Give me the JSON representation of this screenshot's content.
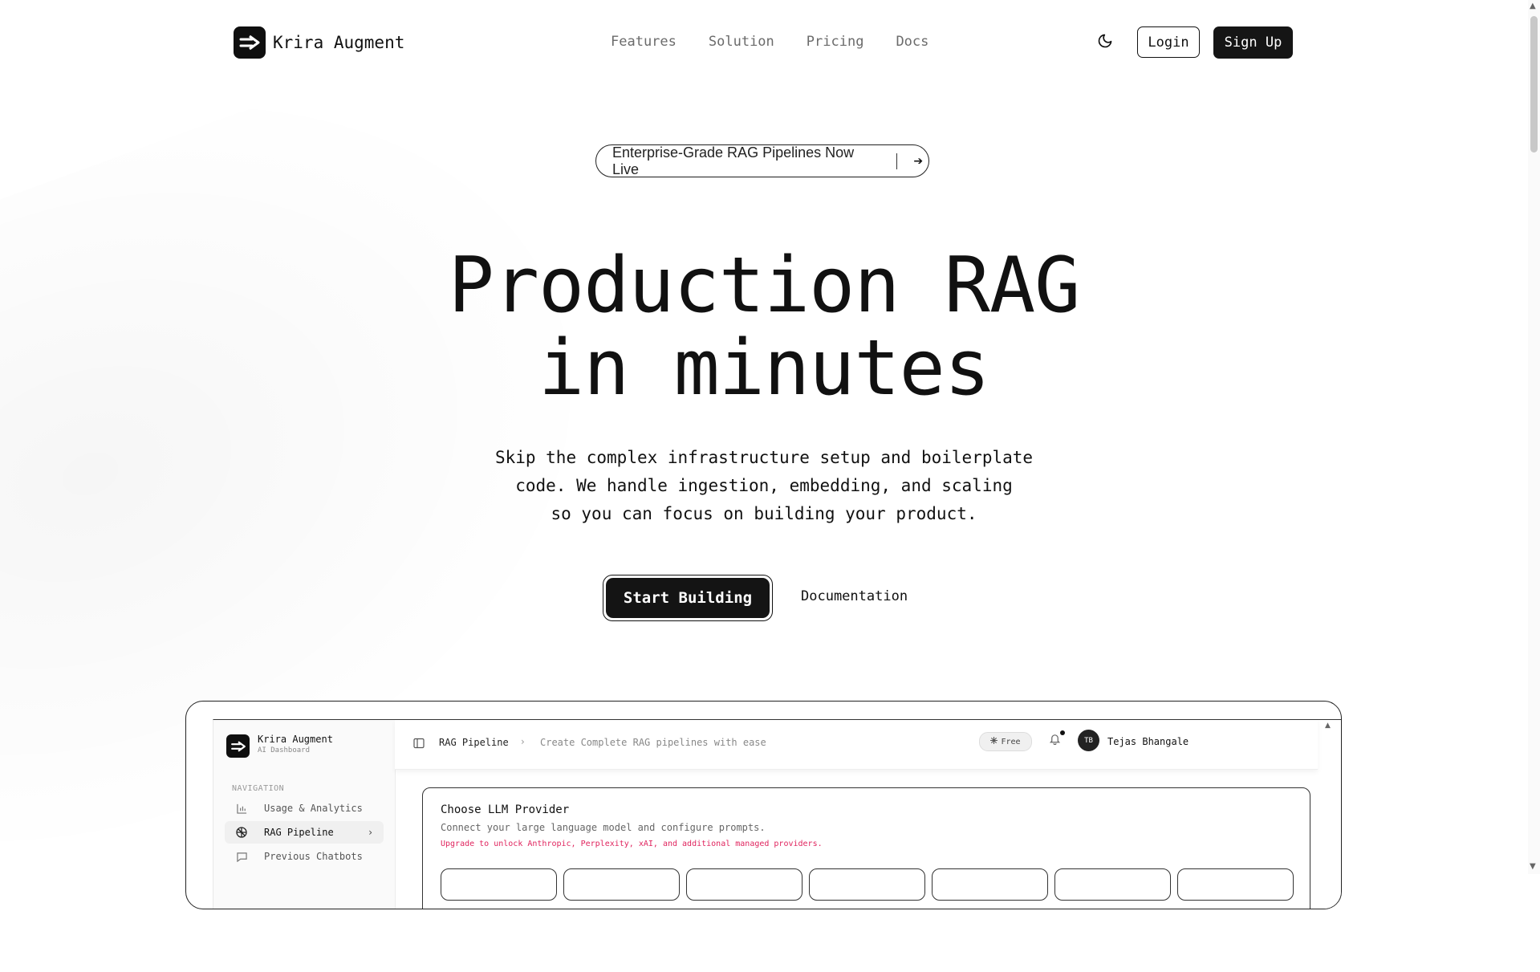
{
  "header": {
    "brand_name": "Krira Augment",
    "nav": [
      "Features",
      "Solution",
      "Pricing",
      "Docs"
    ],
    "login_label": "Login",
    "signup_label": "Sign Up"
  },
  "announcement": {
    "text": "Enterprise-Grade RAG Pipelines Now Live"
  },
  "hero": {
    "title_line1": "Production RAG",
    "title_line2": "in minutes",
    "subtitle_line1": "Skip the complex infrastructure setup and boilerplate",
    "subtitle_line2": "code. We handle ingestion, embedding, and scaling",
    "subtitle_line3": "so you can focus on building your product.",
    "cta_primary": "Start Building",
    "cta_secondary": "Documentation"
  },
  "preview": {
    "sidebar": {
      "brand_name": "Krira Augment",
      "brand_sub": "AI Dashboard",
      "nav_label": "NAVIGATION",
      "items": [
        "Usage & Analytics",
        "RAG Pipeline",
        "Previous Chatbots"
      ]
    },
    "topbar": {
      "crumb_primary": "RAG Pipeline",
      "crumb_secondary": "Create Complete RAG pipelines with ease",
      "plan_badge": "Free",
      "avatar_initials": "TB",
      "user_name": "Tejas Bhangale"
    },
    "card": {
      "title": "Choose LLM Provider",
      "description": "Connect your large language model and configure prompts.",
      "warning": "Upgrade to unlock Anthropic, Perplexity, xAI, and additional managed providers."
    }
  },
  "colors": {
    "primary": "#141414",
    "warning": "#e0245e"
  }
}
